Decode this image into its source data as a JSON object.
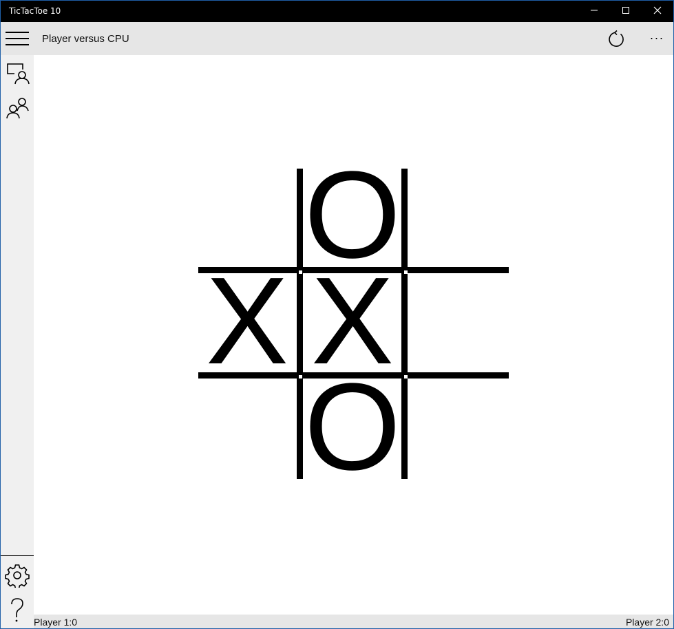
{
  "window": {
    "title": "TicTacToe 10",
    "minimize_icon": "minimize-icon",
    "maximize_icon": "maximize-icon",
    "close_icon": "close-icon"
  },
  "appbar": {
    "menu_icon": "hamburger-icon",
    "title": "Player versus CPU",
    "refresh_icon": "refresh-icon",
    "more_label": "···"
  },
  "sidebar": {
    "items": [
      {
        "icon": "player-vs-cpu-icon"
      },
      {
        "icon": "player-vs-player-icon"
      }
    ],
    "bottom_items": [
      {
        "icon": "settings-icon"
      },
      {
        "icon": "help-icon"
      }
    ]
  },
  "board": {
    "cells": [
      [
        "",
        "O",
        ""
      ],
      [
        "X",
        "X",
        ""
      ],
      [
        "",
        "O",
        ""
      ]
    ]
  },
  "status": {
    "player1_score": "Player 1:0",
    "player2_score": "Player 2:0"
  },
  "colors": {
    "titlebar": "#000000",
    "appbar": "#e6e6e6",
    "sidebar": "#f0f0f0",
    "grid": "#000000"
  }
}
